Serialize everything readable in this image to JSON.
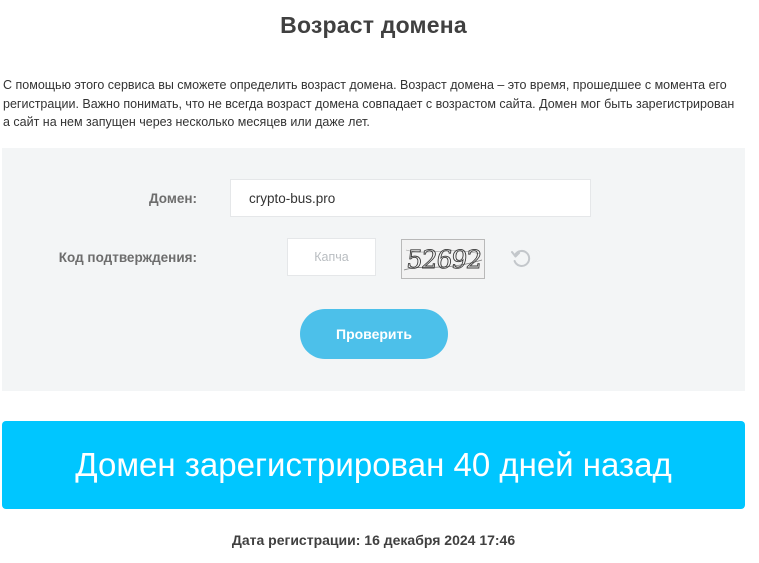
{
  "page": {
    "title": "Возраст домена",
    "description": "С помощью этого сервиса вы сможете определить возраст домена. Возраст домена – это время, прошедшее с момента его регистрации. Важно понимать, что не всегда возраст домена совпадает с возрастом сайта. Домен мог быть зарегистрирован а сайт на нем запущен через несколько месяцев или даже лет."
  },
  "form": {
    "domain_label": "Домен:",
    "domain_value": "crypto-bus.pro",
    "captcha_label": "Код подтверждения:",
    "captcha_placeholder": "Капча",
    "captcha_value": "",
    "captcha_image_text": "52692",
    "refresh_icon": "refresh-icon",
    "submit_label": "Проверить"
  },
  "result": {
    "banner": "Домен зарегистрирован 40 дней назад",
    "registration_date": "Дата регистрации: 16 декабря 2024 17:46"
  },
  "colors": {
    "accent": "#00c6ff",
    "button": "#4cc0ea",
    "panel_bg": "#f3f5f6"
  }
}
